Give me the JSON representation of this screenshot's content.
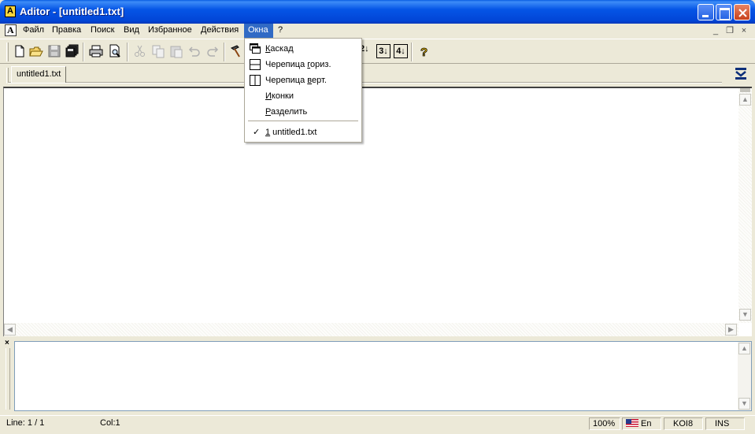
{
  "window": {
    "app_icon_glyph": "A",
    "title": "Aditor - [untitled1.txt]"
  },
  "menubar": {
    "items": [
      {
        "label": "Файл",
        "icon": "menu"
      },
      {
        "label": "Правка"
      },
      {
        "label": "Поиск"
      },
      {
        "label": "Вид"
      },
      {
        "label": "Избранное"
      },
      {
        "label": "Действия"
      },
      {
        "label": "Окна",
        "active": true
      },
      {
        "label": "?"
      }
    ],
    "mdi_minimize": "_",
    "mdi_restore": "❐",
    "mdi_close": "×"
  },
  "toolbar": {
    "tools": [
      {
        "icon": "new-file-icon"
      },
      {
        "icon": "open-folder-icon"
      },
      {
        "icon": "save-icon"
      },
      {
        "icon": "save-all-icon"
      },
      {
        "icon": "print-icon"
      },
      {
        "icon": "print-preview-icon"
      },
      {
        "icon": "cut-icon"
      },
      {
        "icon": "copy-icon"
      },
      {
        "icon": "paste-icon"
      },
      {
        "icon": "undo-icon"
      },
      {
        "icon": "redo-icon"
      },
      {
        "icon": "tools-icon"
      },
      {
        "icon": "bookmark-2-icon",
        "label": "2↓"
      },
      {
        "icon": "bookmark-3-icon",
        "label": "3↓"
      },
      {
        "icon": "bookmark-4-icon",
        "label": "4↓"
      },
      {
        "icon": "help-icon"
      }
    ]
  },
  "tabs": [
    {
      "label": "untitled1.txt"
    }
  ],
  "windows_menu": {
    "items": [
      {
        "label_pre": "",
        "label_u": "К",
        "label_post": "аскад",
        "icon": "cascade-icon"
      },
      {
        "label_pre": "Черепица ",
        "label_u": "г",
        "label_post": "ориз.",
        "icon": "tile-horizontal-icon"
      },
      {
        "label_pre": "Черепица ",
        "label_u": "в",
        "label_post": "ерт.",
        "icon": "tile-vertical-icon"
      },
      {
        "label_pre": "",
        "label_u": "И",
        "label_post": "конки",
        "icon": ""
      },
      {
        "label_pre": "",
        "label_u": "Р",
        "label_post": "азделить",
        "icon": ""
      }
    ],
    "open_window": {
      "check": "✓",
      "number": "1",
      "name": " untitled1.txt"
    }
  },
  "output_panel": {
    "close": "×"
  },
  "statusbar": {
    "line": "Line: 1 / 1",
    "col": "Col:1",
    "zoom": "100%",
    "lang": "En",
    "encoding": "KOI8",
    "mode": "INS"
  }
}
